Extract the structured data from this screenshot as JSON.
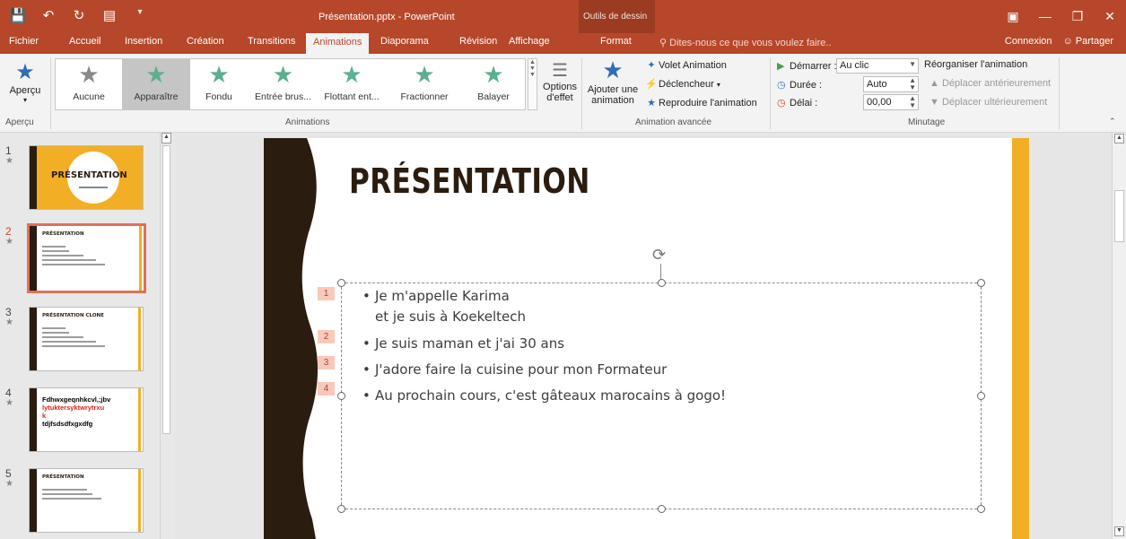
{
  "window": {
    "title": "Présentation.pptx - PowerPoint",
    "context_tab_group": "Outils de dessin"
  },
  "tabs": {
    "items": [
      "Fichier",
      "Accueil",
      "Insertion",
      "Création",
      "Transitions",
      "Animations",
      "Diaporama",
      "Révision",
      "Affichage",
      "Format"
    ],
    "active": "Animations",
    "tell_me": "Dites-nous ce que vous voulez faire..",
    "signin": "Connexion",
    "share": "Partager"
  },
  "ribbon": {
    "apercu": {
      "label": "Aperçu",
      "group": "Aperçu"
    },
    "animations_group": "Animations",
    "gallery": [
      {
        "label": "Aucune",
        "color": "#8a8a8a",
        "selected": false
      },
      {
        "label": "Apparaître",
        "color": "#5cb08f",
        "selected": true
      },
      {
        "label": "Fondu",
        "color": "#5cb08f",
        "selected": false
      },
      {
        "label": "Entrée brus...",
        "color": "#5cb08f",
        "selected": false
      },
      {
        "label": "Flottant ent...",
        "color": "#5cb08f",
        "selected": false
      },
      {
        "label": "Fractionner",
        "color": "#5cb08f",
        "selected": false
      },
      {
        "label": "Balayer",
        "color": "#5cb08f",
        "selected": false
      }
    ],
    "effect_options": [
      "Options",
      "d'effet"
    ],
    "advanced": {
      "group": "Animation avancée",
      "add_animation": [
        "Ajouter une",
        "animation"
      ],
      "pane": "Volet Animation",
      "trigger": "Déclencheur",
      "painter": "Reproduire l'animation"
    },
    "timing": {
      "group": "Minutage",
      "start_label": "Démarrer :",
      "start_value": "Au clic",
      "duration_label": "Durée :",
      "duration_value": "Auto",
      "delay_label": "Délai :",
      "delay_value": "00,00",
      "reorder": "Réorganiser l'animation",
      "move_earlier": "Déplacer antérieurement",
      "move_later": "Déplacer ultérieurement"
    }
  },
  "thumbnails": [
    {
      "num": "1",
      "title": "PRÉSENTATION",
      "active": false
    },
    {
      "num": "2",
      "title": "PRÉSENTATION",
      "active": true
    },
    {
      "num": "3",
      "title": "PRÉSENTATION CLONE",
      "active": false
    },
    {
      "num": "4",
      "lines": [
        "Fdhwxgeqnhkcvl,;jbv",
        "lytuktersyktwrytrxu",
        "k",
        "tdjfsdsdfxgxdfg"
      ],
      "active": false
    },
    {
      "num": "5",
      "title": "PRÉSENTATION",
      "active": false
    }
  ],
  "slide": {
    "title": "PRÉSENTATION",
    "bullets": [
      {
        "tag": "1",
        "line1": "Je m'appelle Karima",
        "line2": "et je suis à Koekeltech"
      },
      {
        "tag": "2",
        "line1": "Je suis maman et j'ai 30 ans"
      },
      {
        "tag": "3",
        "line1": "J'adore faire la cuisine pour mon Formateur"
      },
      {
        "tag": "4",
        "line1": "Au prochain cours, c'est gâteaux marocains à gogo!"
      }
    ]
  },
  "colors": {
    "accent": "#b7472a",
    "slide_dark": "#2b1c10",
    "slide_stripe": "#f2ae24"
  }
}
